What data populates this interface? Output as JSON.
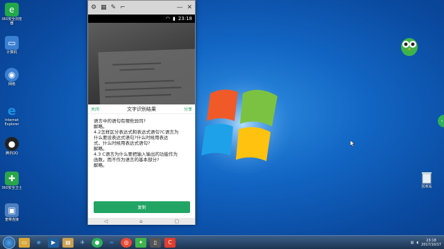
{
  "desktop": {
    "icons": [
      {
        "label": "360安全浏览器",
        "icon": "browser-360-icon",
        "color": "#22a84a"
      },
      {
        "label": "计算机",
        "icon": "computer-icon",
        "color": "#3b7fd0"
      },
      {
        "label": "网络",
        "icon": "network-icon",
        "color": "#3b7fd0"
      },
      {
        "label": "Internet Explorer",
        "icon": "ie-icon",
        "color": "#1e8fe0"
      },
      {
        "label": "腾讯QQ",
        "icon": "qq-icon",
        "color": "#222"
      },
      {
        "label": "360安全卫士",
        "icon": "shield-360-icon",
        "color": "#2aa64a"
      },
      {
        "label": "宽带连接",
        "icon": "broadband-icon",
        "color": "#4b7fc0"
      }
    ],
    "recycle_label": "回收站"
  },
  "phone": {
    "status_time": "23:18",
    "result": {
      "close_label": "关闭",
      "title": "文字识别结果",
      "share_label": "分享",
      "lines": [
        "语言中的语句有哪些异同?",
        "解略。",
        "4.2怎样区分表达式和表达式语句?C语言为",
        "什么要设表达式语句?什么时候用表达",
        "式，什么时候用表达式语句?",
        "解略。",
        "4.3 C语言为什么要把输入输出的功能作为",
        "函数，而不作为语言的基本部分?",
        "解略。"
      ],
      "copy_label": "复制"
    }
  },
  "taskbar": {
    "apps": [
      "file-explorer-icon",
      "ie-icon",
      "media-player-icon",
      "folder-icon",
      "plane-icon",
      "green-app-icon",
      "baidu-icon",
      "chrome-icon",
      "puzzle-icon",
      "phone-app-icon",
      "red-app-icon"
    ],
    "clock_time": "23:18",
    "clock_date": "2017/10/17"
  },
  "colors": {
    "accent_green": "#22a564",
    "wallpaper_blue": "#1266c4"
  }
}
